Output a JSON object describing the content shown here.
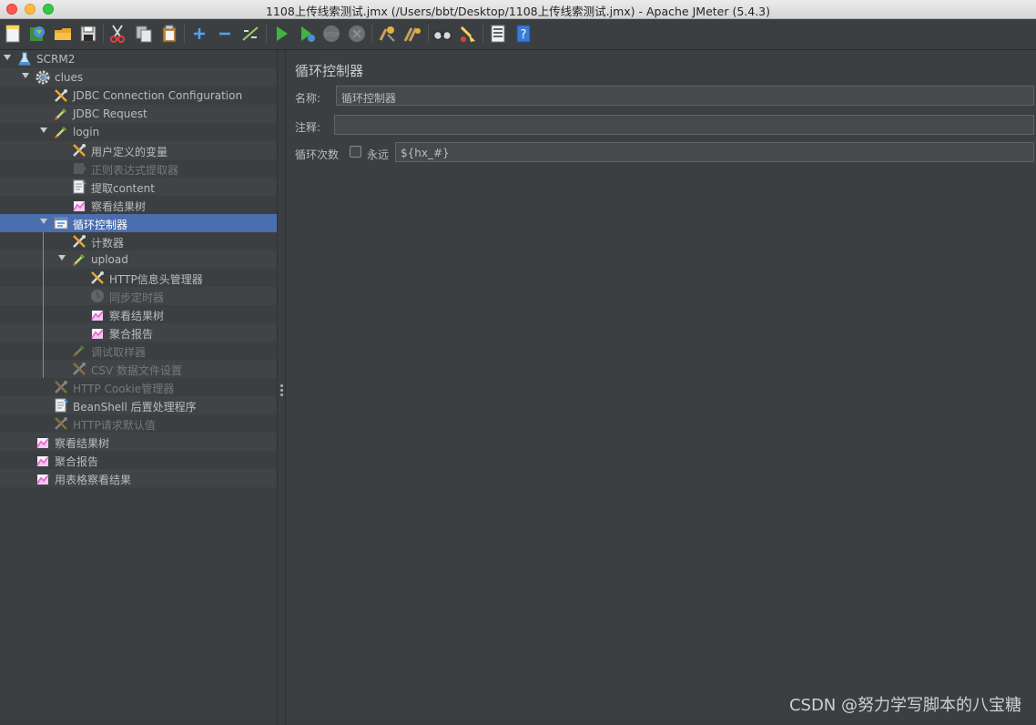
{
  "window": {
    "title": "1108上传线索测试.jmx (/Users/bbt/Desktop/1108上传线索测试.jmx) - Apache JMeter (5.4.3)"
  },
  "toolbar": {
    "buttons": [
      {
        "name": "new",
        "icon": "new-file-icon"
      },
      {
        "name": "templates",
        "icon": "templates-icon"
      },
      {
        "name": "open",
        "icon": "open-folder-icon"
      },
      {
        "name": "save",
        "icon": "save-disk-icon"
      },
      {
        "name": "cut",
        "icon": "scissors-icon"
      },
      {
        "name": "copy",
        "icon": "copy-icon"
      },
      {
        "name": "paste",
        "icon": "paste-icon"
      },
      {
        "name": "expand",
        "icon": "plus-icon"
      },
      {
        "name": "collapse",
        "icon": "minus-icon"
      },
      {
        "name": "toggle",
        "icon": "toggle-icon"
      },
      {
        "name": "start",
        "icon": "play-icon"
      },
      {
        "name": "start-no-pauses",
        "icon": "play-no-pause-icon"
      },
      {
        "name": "stop",
        "icon": "stop-icon"
      },
      {
        "name": "shutdown",
        "icon": "shutdown-icon"
      },
      {
        "name": "clear",
        "icon": "clear-broom-icon"
      },
      {
        "name": "clear-all",
        "icon": "clear-all-broom-icon"
      },
      {
        "name": "search",
        "icon": "binoculars-icon"
      },
      {
        "name": "reset-search",
        "icon": "reset-search-broom-icon"
      },
      {
        "name": "function-helper",
        "icon": "function-list-icon"
      },
      {
        "name": "help",
        "icon": "help-book-icon"
      }
    ]
  },
  "tree": {
    "items": [
      {
        "label": "SCRM2",
        "level": 0,
        "expanded": true,
        "icon": "flask-icon",
        "disabled": false
      },
      {
        "label": "clues",
        "level": 1,
        "expanded": true,
        "icon": "gear-icon",
        "disabled": false
      },
      {
        "label": "JDBC Connection Configuration",
        "level": 2,
        "icon": "wrench-screwdriver-icon",
        "disabled": false
      },
      {
        "label": "JDBC Request",
        "level": 2,
        "icon": "pipette-icon",
        "disabled": false
      },
      {
        "label": "login",
        "level": 2,
        "expanded": true,
        "icon": "pipette-icon",
        "disabled": false
      },
      {
        "label": "用户定义的变量",
        "level": 3,
        "icon": "wrench-screwdriver-icon",
        "disabled": false
      },
      {
        "label": "正则表达式提取器",
        "level": 3,
        "icon": "extractor-icon",
        "disabled": true
      },
      {
        "label": "提取content",
        "level": 3,
        "icon": "document-icon",
        "disabled": false
      },
      {
        "label": "察看结果树",
        "level": 3,
        "icon": "graph-icon",
        "disabled": false
      },
      {
        "label": "循环控制器",
        "level": 2,
        "expanded": true,
        "icon": "loop-controller-icon",
        "disabled": false,
        "selected": true
      },
      {
        "label": "计数器",
        "level": 3,
        "icon": "wrench-screwdriver-icon",
        "disabled": false
      },
      {
        "label": "upload",
        "level": 3,
        "expanded": true,
        "icon": "pipette-icon",
        "disabled": false
      },
      {
        "label": "HTTP信息头管理器",
        "level": 4,
        "icon": "wrench-screwdriver-icon",
        "disabled": false
      },
      {
        "label": "同步定时器",
        "level": 4,
        "icon": "timer-icon",
        "disabled": true
      },
      {
        "label": "察看结果树",
        "level": 4,
        "icon": "graph-icon",
        "disabled": false
      },
      {
        "label": "聚合报告",
        "level": 4,
        "icon": "graph-icon",
        "disabled": false
      },
      {
        "label": "调试取样器",
        "level": 3,
        "icon": "pipette-icon",
        "disabled": true
      },
      {
        "label": "CSV 数据文件设置",
        "level": 3,
        "icon": "wrench-screwdriver-icon",
        "disabled": true
      },
      {
        "label": "HTTP Cookie管理器",
        "level": 2,
        "icon": "wrench-screwdriver-icon",
        "disabled": true
      },
      {
        "label": "BeanShell 后置处理程序",
        "level": 2,
        "icon": "document-icon",
        "disabled": false
      },
      {
        "label": "HTTP请求默认值",
        "level": 2,
        "icon": "wrench-screwdriver-icon",
        "disabled": true
      },
      {
        "label": "察看结果树",
        "level": 1,
        "icon": "graph-icon",
        "disabled": false
      },
      {
        "label": "聚合报告",
        "level": 1,
        "icon": "graph-icon",
        "disabled": false
      },
      {
        "label": "用表格察看结果",
        "level": 1,
        "icon": "graph-icon",
        "disabled": false
      }
    ]
  },
  "panel": {
    "title": "循环控制器",
    "name_label": "名称:",
    "name_value": "循环控制器",
    "comment_label": "注释:",
    "comment_value": "",
    "loop_label": "循环次数",
    "forever_label": "永远",
    "forever_checked": false,
    "loop_value": "${hx_#}"
  },
  "watermark": "CSDN @努力学写脚本的八宝糖"
}
